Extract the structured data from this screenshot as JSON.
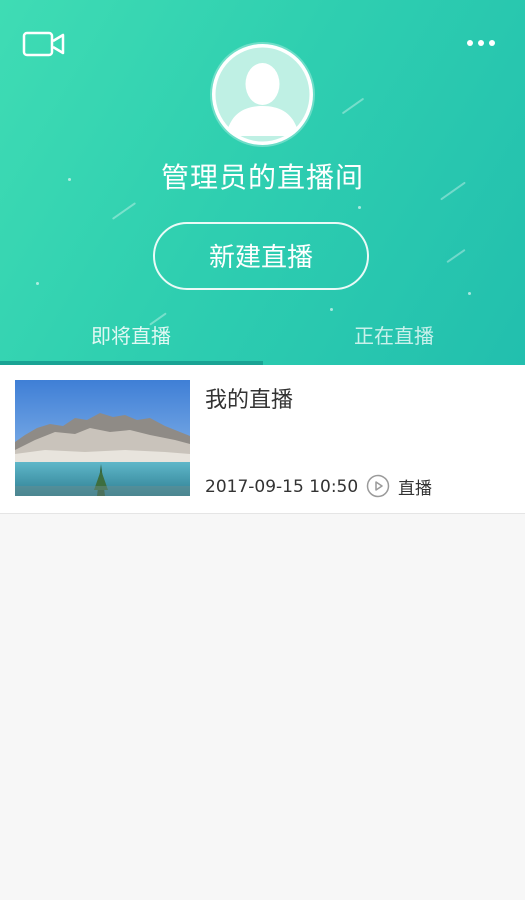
{
  "header": {
    "room_title": "管理员的直播间",
    "new_live_label": "新建直播",
    "tabs": [
      {
        "label": "即将直播",
        "active": true
      },
      {
        "label": "正在直播",
        "active": false
      }
    ],
    "icons": {
      "left": "video-camera-icon",
      "right": "more-icon",
      "avatar": "default-avatar-icon"
    }
  },
  "list": {
    "items": [
      {
        "title": "我的直播",
        "time": "2017-09-15 10:50",
        "status": "直播",
        "status_icon": "play-circle-icon",
        "thumbnail": "mountain-lake-image"
      }
    ]
  },
  "colors": {
    "header_gradient_start": "#3fdcb4",
    "header_gradient_end": "#22bfae",
    "tab_indicator": "#1aa394",
    "background": "#f7f7f7"
  }
}
